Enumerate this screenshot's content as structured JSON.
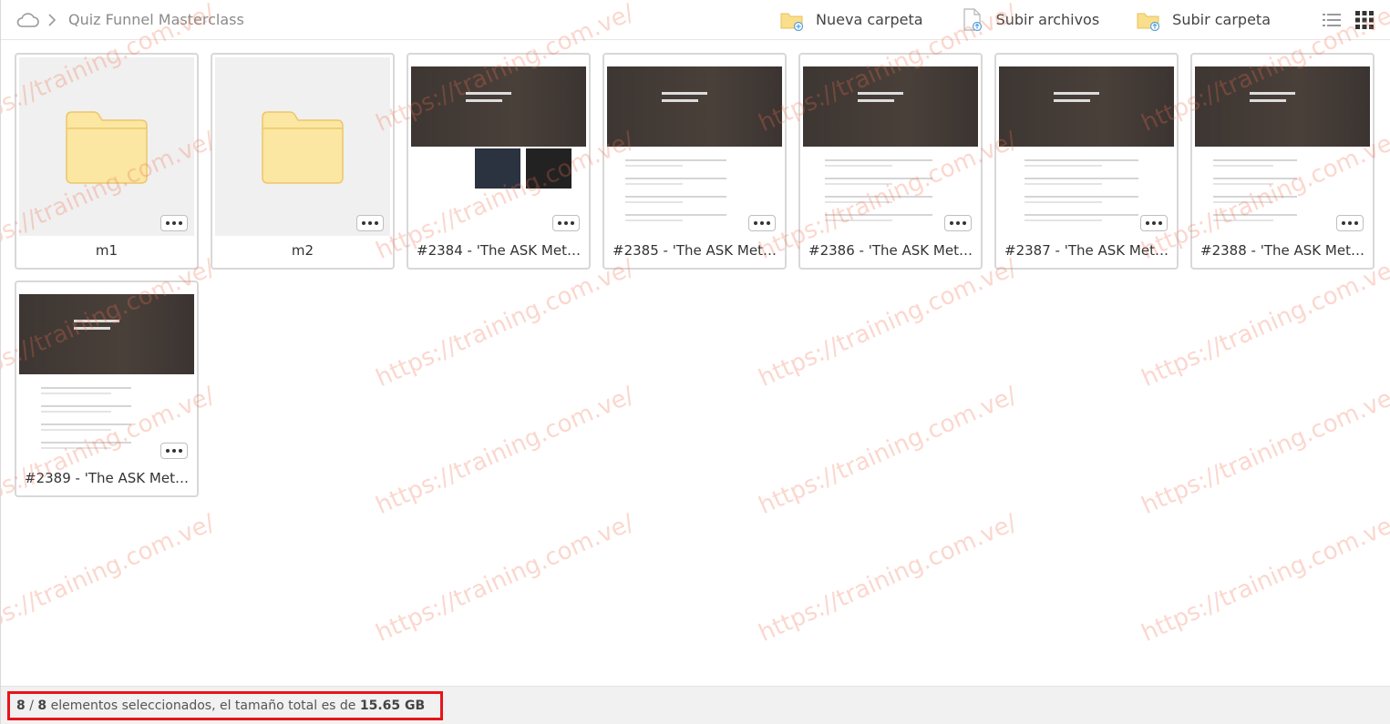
{
  "breadcrumb": {
    "title": "Quiz Funnel Masterclass"
  },
  "toolbar": {
    "new_folder": "Nueva carpeta",
    "upload_files": "Subir archivos",
    "upload_folder": "Subir carpeta"
  },
  "items": [
    {
      "type": "folder",
      "name": "m1"
    },
    {
      "type": "folder",
      "name": "m2"
    },
    {
      "type": "doc",
      "name": "#2384 - 'The ASK Met…"
    },
    {
      "type": "doc",
      "name": "#2385 - 'The ASK Met…"
    },
    {
      "type": "doc",
      "name": "#2386 - 'The ASK Met…"
    },
    {
      "type": "doc",
      "name": "#2387 - 'The ASK Met…"
    },
    {
      "type": "doc",
      "name": "#2388 - 'The ASK Met…"
    },
    {
      "type": "doc",
      "name": "#2389 - 'The ASK Met…"
    }
  ],
  "status": {
    "selected": "8",
    "separator": " / ",
    "total": "8",
    "text": " elementos seleccionados, el tamaño total es de ",
    "size": "15.65 GB"
  },
  "watermark": "https://training.com.ve/",
  "colors": {
    "highlight": "#e8141b",
    "folder": "#fbe7a1"
  }
}
